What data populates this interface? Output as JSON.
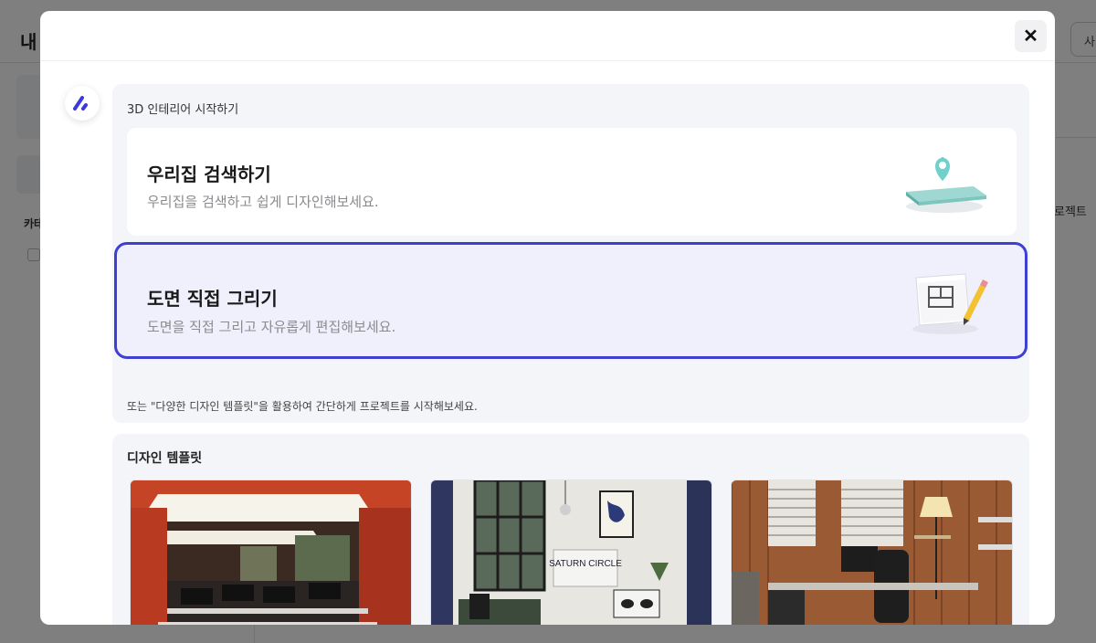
{
  "background": {
    "page_title": "내",
    "label_category": "카테",
    "right_button": "사",
    "right_tab": "로젝트"
  },
  "modal": {
    "close_label": "✕",
    "start": {
      "section_title": "3D 인테리어 시작하기",
      "options": [
        {
          "title": "우리집 검색하기",
          "desc": "우리집을 검색하고 쉽게 디자인해보세요.",
          "icon": "map-pin-phone-icon"
        },
        {
          "title": "도면 직접 그리기",
          "desc": "도면을 직접 그리고 자유롭게 편집해보세요.",
          "icon": "floorplan-pencil-icon",
          "selected": true
        }
      ],
      "alt_text": "또는 \"다양한 디자인 템플릿\"을 활용하여 간단하게 프로젝트를 시작해보세요."
    },
    "templates": {
      "title": "디자인 템플릿",
      "items": [
        {
          "image": "office-red-interior"
        },
        {
          "image": "saturn-circle-room",
          "sign_text": "SATURN CIRCLE"
        },
        {
          "image": "wood-office-room"
        }
      ]
    }
  },
  "colors": {
    "accent": "#3f3fd4",
    "selected_bg": "#eff0fb",
    "section_bg": "#f4f5f8"
  }
}
